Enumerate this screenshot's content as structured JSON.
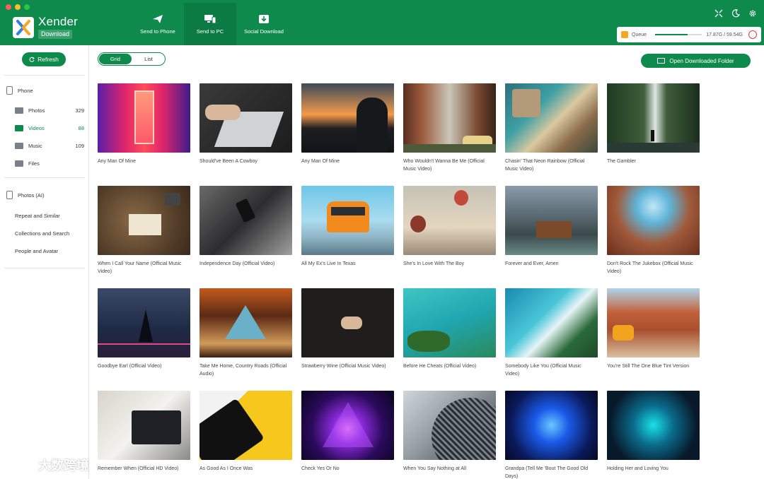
{
  "app": {
    "name": "Xender",
    "subtitle": "Download"
  },
  "nav": [
    {
      "label": "Send to Phone",
      "icon": "paper-plane-icon",
      "active": false
    },
    {
      "label": "Send to PC",
      "icon": "monitor-icon",
      "active": true
    },
    {
      "label": "Social Download",
      "icon": "download-tray-icon",
      "active": false
    }
  ],
  "top_icons": [
    "collapse-icon",
    "moon-icon",
    "gear-icon"
  ],
  "queue": {
    "label": "Queue",
    "storage": "17.87G / 59.54G",
    "fill_fraction": 0.7
  },
  "sidebar": {
    "refresh_label": "Refresh",
    "phone_label": "Phone",
    "phone_items": [
      {
        "label": "Photos",
        "count": "329"
      },
      {
        "label": "Videos",
        "count": "88"
      },
      {
        "label": "Music",
        "count": "109"
      },
      {
        "label": "Files",
        "count": ""
      }
    ],
    "ai_label": "Photos (AI)",
    "ai_items": [
      {
        "label": "Repeat and Similar"
      },
      {
        "label": "Collections and Search"
      },
      {
        "label": "People and Avatar"
      }
    ]
  },
  "view_toggle": {
    "grid": "Grid",
    "list": "List"
  },
  "open_folder_label": "Open Downloaded Folder",
  "videos": [
    {
      "title": "Any Man Of Mine"
    },
    {
      "title": "Should've Been A Cowboy"
    },
    {
      "title": "Any Man Of Mine"
    },
    {
      "title": "Who Wouldn't Wanna Be Me (Official Music Video)"
    },
    {
      "title": "Chasin' That Neon Rainbow (Official Music Video)"
    },
    {
      "title": "The Gambler"
    },
    {
      "title": "When I Call Your Name (Official Music Video)"
    },
    {
      "title": "Independence Day (Official Video)"
    },
    {
      "title": "All My Ex's Live In Texas"
    },
    {
      "title": "She's In Love With The Boy"
    },
    {
      "title": "Forever and Ever, Amen"
    },
    {
      "title": "Don't Rock The Jukebox (Official Music Video)"
    },
    {
      "title": "Goodbye Earl (Official Video)"
    },
    {
      "title": "Take Me Home, Country Roads (Official Audio)"
    },
    {
      "title": "Strawberry Wine (Official Music Video)"
    },
    {
      "title": "Before He Cheats (Official Video)"
    },
    {
      "title": "Somebody Like You (Official Music Video)"
    },
    {
      "title": "You're Still The One Blue Tint Version"
    },
    {
      "title": "Remember When (Official HD Video)"
    },
    {
      "title": "As Good As I Once Was"
    },
    {
      "title": "Check Yes Or No"
    },
    {
      "title": "When You Say Nothing at All"
    },
    {
      "title": "Grandpa (Tell Me 'Bout The Good Old Days)"
    },
    {
      "title": "Holding Her and Loving You"
    }
  ],
  "watermark": "大数跨境",
  "colors": {
    "brand": "#0d8a4c",
    "brand_dark": "#0b7a43",
    "accent": "#f5a623",
    "danger": "#e04040"
  }
}
